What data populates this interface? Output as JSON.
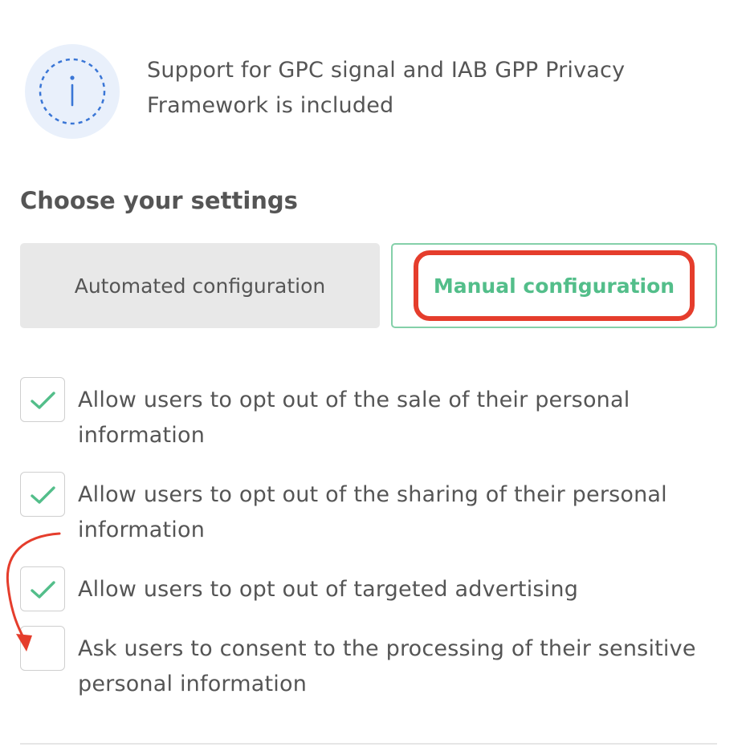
{
  "info": {
    "icon": "info-icon",
    "text": "Support for GPC signal and IAB GPP Privacy Framework is included"
  },
  "settings": {
    "title": "Choose your settings",
    "options": [
      {
        "label": "Automated configuration",
        "selected": false
      },
      {
        "label": "Manual configuration",
        "selected": true
      }
    ]
  },
  "checkboxes": [
    {
      "label": "Allow users to opt out of the sale of their personal information",
      "checked": true
    },
    {
      "label": "Allow users to opt out of the sharing of their personal information",
      "checked": true
    },
    {
      "label": "Allow users to opt out of targeted advertising",
      "checked": true
    },
    {
      "label": "Ask users to consent to the processing of their sensitive personal information",
      "checked": false
    }
  ],
  "colors": {
    "accent_green": "#53be8a",
    "annotation_red": "#e53d2c",
    "info_blue": "#3a76d6",
    "text_gray": "#555555"
  }
}
